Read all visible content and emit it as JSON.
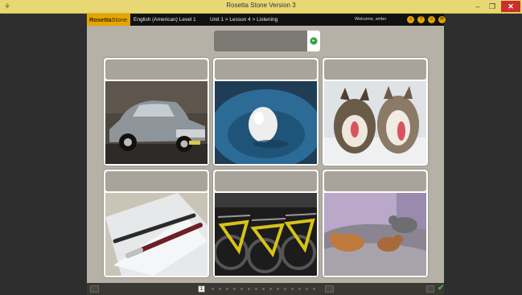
{
  "window": {
    "title": "Rosetta Stone Version 3",
    "minimize": "–",
    "maximize": "❐",
    "close": "✕"
  },
  "header": {
    "logo_main": "Rosetta",
    "logo_sub": "Stone",
    "course": "English (American) Level 1",
    "breadcrumb": "Unit 1 > Lesson 4 > Listening",
    "welcome": "Welcome, writer"
  },
  "cards": [
    {
      "subject": "classic-car"
    },
    {
      "subject": "egg-in-bowl"
    },
    {
      "subject": "sled-dogs"
    },
    {
      "subject": "pens-on-paper"
    },
    {
      "subject": "bicycles"
    },
    {
      "subject": "cats-on-bed"
    }
  ],
  "footer": {
    "current_page": "1"
  },
  "colors": {
    "brand_gold": "#e6a400",
    "title_bar": "#e8d873",
    "stage": "#b6b1a6",
    "check": "#3cb44b"
  }
}
